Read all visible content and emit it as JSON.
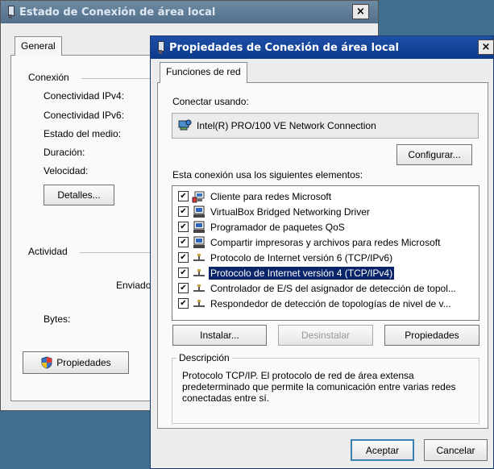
{
  "back_window": {
    "title": "Estado de Conexión de área local",
    "close": "×",
    "tab": "General",
    "connection_section": "Conexión",
    "labels": [
      "Conectividad IPv4:",
      "Conectividad IPv6:",
      "Estado del medio:",
      "Duración:",
      "Velocidad:"
    ],
    "details_button": "Detalles...",
    "activity_section": "Actividad",
    "sent_label": "Enviado",
    "bytes_label": "Bytes:",
    "properties_button": "Propiedades"
  },
  "front_window": {
    "title": "Propiedades de Conexión de área local",
    "close": "×",
    "tab": "Funciones de red",
    "connect_using_label": "Conectar usando:",
    "adapter_name": "Intel(R) PRO/100 VE Network Connection",
    "configure_button": "Configurar...",
    "items_label": "Esta conexión usa los siguientes elementos:",
    "items": [
      {
        "label": "Cliente para redes Microsoft",
        "checked": "✔",
        "icon": "network-client-icon"
      },
      {
        "label": "VirtualBox Bridged Networking Driver",
        "checked": "✔",
        "icon": "network-service-icon"
      },
      {
        "label": "Programador de paquetes QoS",
        "checked": "✔",
        "icon": "network-service-icon"
      },
      {
        "label": "Compartir impresoras y archivos para redes Microsoft",
        "checked": "✔",
        "icon": "network-service-icon"
      },
      {
        "label": "Protocolo de Internet versión 6 (TCP/IPv6)",
        "checked": "✔",
        "icon": "protocol-icon"
      },
      {
        "label": "Protocolo de Internet versión 4 (TCP/IPv4)",
        "checked": "✔",
        "icon": "protocol-icon"
      },
      {
        "label": "Controlador de E/S del asignador de detección de topol...",
        "checked": "✔",
        "icon": "protocol-icon"
      },
      {
        "label": "Respondedor de detección de topologías de nivel de v...",
        "checked": "✔",
        "icon": "protocol-icon"
      }
    ],
    "selected_index": 5,
    "install_button": "Instalar...",
    "uninstall_button": "Desinstalar",
    "properties_button": "Propiedades",
    "description_title": "Descripción",
    "description_text": "Protocolo TCP/IP. El protocolo de red de área extensa predeterminado que permite la comunicación entre varias redes conectadas entre sí.",
    "ok_button": "Aceptar",
    "cancel_button": "Cancelar"
  },
  "colors": {
    "desktop": "#3f6f8f",
    "title_active": "#0b3a8c",
    "title_inactive": "#52708b",
    "selection": "#0a246a"
  }
}
